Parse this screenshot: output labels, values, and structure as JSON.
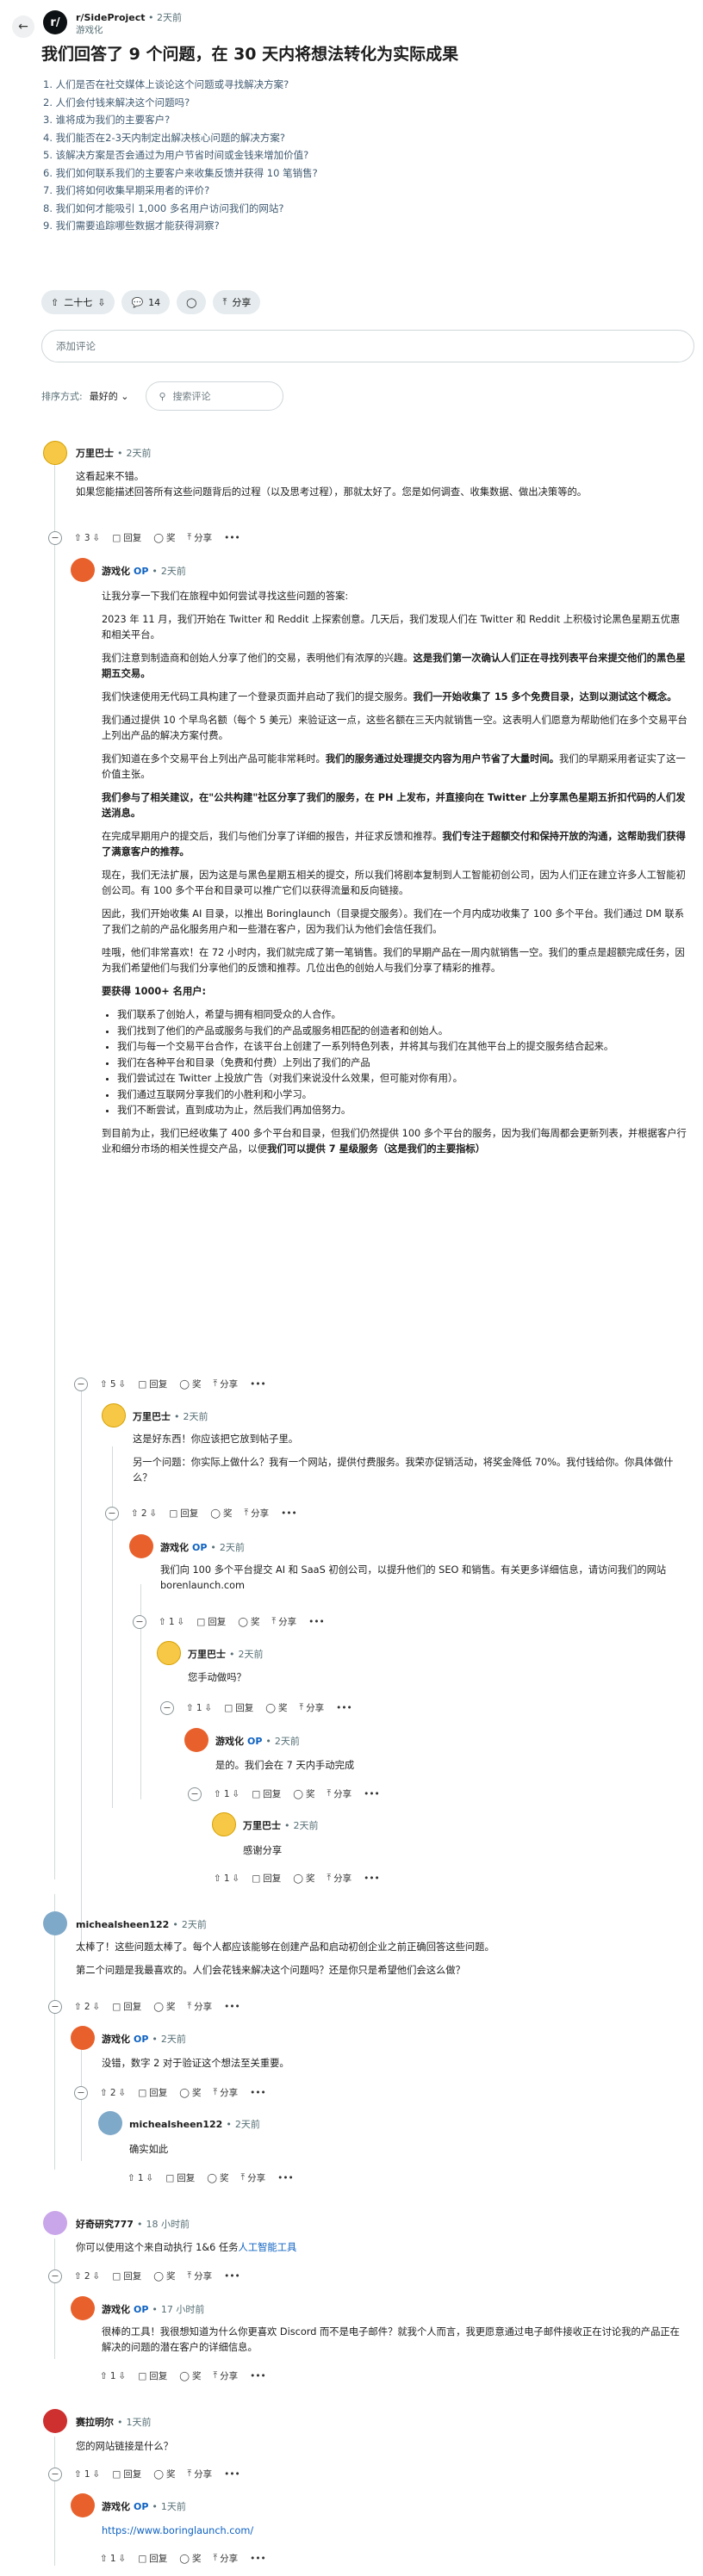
{
  "header": {
    "subreddit": "r/SideProject",
    "age": "2天前",
    "author": "游戏化",
    "title": "我们回答了 9 个问题，在 30 天内将想法转化为实际成果"
  },
  "questions": [
    "1. 人们是否在社交媒体上谈论这个问题或寻找解决方案?",
    "2. 人们会付钱来解决这个问题吗?",
    "3. 谁将成为我们的主要客户?",
    "4. 我们能否在2-3天内制定出解决核心问题的解决方案?",
    "5. 该解决方案是否会通过为用户节省时间或金钱来增加价值?",
    "6. 我们如何联系我们的主要客户来收集反馈并获得 10 笔销售?",
    "7. 我们将如何收集早期采用者的评价?",
    "8. 我们如何才能吸引 1,000 多名用户访问我们的网站?",
    "9. 我们需要追踪哪些数据才能获得洞察?"
  ],
  "post_actions": {
    "votes": "二十七",
    "comments": "14",
    "share": "分享"
  },
  "add_comment_placeholder": "添加评论",
  "sort": {
    "label": "排序方式:",
    "value": "最好的",
    "search_placeholder": "搜索评论"
  },
  "labels": {
    "reply": "回复",
    "award": "奖",
    "share": "分享",
    "op": "OP"
  },
  "comments": {
    "c1": {
      "author": "万里巴士",
      "time": "2天前",
      "votes": "3",
      "text": [
        "这看起来不错。",
        "如果您能描述回答所有这些问题背后的过程（以及思考过程），那就太好了。您是如何调查、收集数据、做出决策等的。"
      ]
    },
    "c1r": {
      "author": "游戏化",
      "time": "2天前",
      "votes": "5",
      "p1": "让我分享一下我们在旅程中如何尝试寻找这些问题的答案:",
      "p2": "2023 年 11 月，我们开始在 Twitter 和 Reddit 上探索创意。几天后，我们发现人们在 Twitter 和 Reddit 上积极讨论黑色星期五优惠和相关平台。",
      "p3a": "我们注意到制造商和创始人分享了他们的交易，表明他们有浓厚的兴趣。",
      "p3b": "这是我们第一次确认人们正在寻找列表平台来提交他们的黑色星期五交易。",
      "p4a": "我们快速使用无代码工具构建了一个登录页面并启动了我们的提交服务。",
      "p4b": "我们一开始收集了 15 多个免费目录，达到以测试这个概念。",
      "p5": "我们通过提供 10 个早鸟名额（每个 5 美元）来验证这一点，这些名额在三天内就销售一空。这表明人们愿意为帮助他们在多个交易平台上列出产品的解决方案付费。",
      "p6a": "我们知道在多个交易平台上列出产品可能非常耗时。",
      "p6b": "我们的服务通过处理提交内容为用户节省了大量时间。",
      "p6c": "我们的早期采用者证实了这一价值主张。",
      "p7": "我们参与了相关建议，在\"公共构建\"社区分享了我们的服务，在 PH 上发布，并直接向在 Twitter 上分享黑色星期五折扣代码的人们发送消息。",
      "p8a": "在完成早期用户的提交后，我们与他们分享了详细的报告，并征求反馈和推荐。",
      "p8b": "我们专注于超额交付和保持开放的沟通，这帮助我们获得了满意客户的推荐。",
      "p9": "现在，我们无法扩展，因为这是与黑色星期五相关的提交，所以我们将剧本复制到人工智能初创公司，因为人们正在建立许多人工智能初创公司。有 100 多个平台和目录可以推广它们以获得流量和反向链接。",
      "p10": "因此，我们开始收集 AI 目录，以推出 Boringlaunch（目录提交服务）。我们在一个月内成功收集了 100 多个平台。我们通过 DM 联系了我们之前的产品化服务用户和一些潜在客户，因为我们认为他们会信任我们。",
      "p11": "哇哦，他们非常喜欢！在 72 小时内，我们就完成了第一笔销售。我们的早期产品在一周内就销售一空。我们的重点是超额完成任务，因为我们希望他们与我们分享他们的反馈和推荐。几位出色的创始人与我们分享了精彩的推荐。",
      "p12": "要获得 1000+ 名用户:",
      "list": [
        "我们联系了创始人，希望与拥有相同受众的人合作。",
        "我们找到了他们的产品或服务与我们的产品或服务相匹配的创造者和创始人。",
        "我们与每一个交易平台合作，在该平台上创建了一系列特色列表，并将其与我们在其他平台上的提交服务结合起来。",
        "我们在各种平台和目录（免费和付费）上列出了我们的产品",
        "我们尝试过在 Twitter 上投放广告（对我们来说没什么效果，但可能对你有用）。",
        "我们通过互联网分享我们的小胜利和小学习。",
        "我们不断尝试，直到成功为止，然后我们再加倍努力。"
      ],
      "p13a": "到目前为止，我们已经收集了 400 多个平台和目录，但我们仍然提供 100 多个平台的服务，因为我们每周都会更新列表，并根据客户行业和细分市场的相关性提交产品，以便",
      "p13b": "我们可以提供 7 星级服务（这是我们的主要指标）"
    },
    "c2": {
      "author": "万里巴士",
      "time": "2天前",
      "votes": "2",
      "text": [
        "这是好东西！你应该把它放到帖子里。",
        "另一个问题：你实际上做什么？我有一个网站，提供付费服务。我荣亦促销活动，将奖金降低 70%。我付钱给你。你具体做什么？"
      ]
    },
    "c3": {
      "author": "游戏化",
      "time": "2天前",
      "votes": "1",
      "text": "我们向 100 多个平台提交 AI 和 SaaS 初创公司，以提升他们的 SEO 和销售。有关更多详细信息，请访问我们的网站 borenlaunch.com"
    },
    "c4": {
      "author": "万里巴士",
      "time": "2天前",
      "votes": "1",
      "text": "您手动做吗？"
    },
    "c5": {
      "author": "游戏化",
      "time": "2天前",
      "votes": "1",
      "text": "是的。我们会在 7 天内手动完成"
    },
    "c6": {
      "author": "万里巴士",
      "time": "2天前",
      "votes": "1",
      "text": "感谢分享"
    },
    "c7": {
      "author": "michealsheen122",
      "time": "2天前",
      "votes": "2",
      "text": [
        "太棒了！这些问题太棒了。每个人都应该能够在创建产品和启动初创企业之前正确回答这些问题。",
        "第二个问题是我最喜欢的。人们会花钱来解决这个问题吗？还是你只是希望他们会这么做？"
      ]
    },
    "c8": {
      "author": "游戏化",
      "time": "2天前",
      "votes": "2",
      "text": "没错，数字 2 对于验证这个想法至关重要。"
    },
    "c9": {
      "author": "michealsheen122",
      "time": "2天前",
      "votes": "1",
      "text": "确实如此"
    },
    "c10": {
      "author": "好奇研究777",
      "time": "18 小时前",
      "votes": "2",
      "text_pre": "你可以使用这个来自动执行 1&6 任务",
      "link": "人工智能工具"
    },
    "c11": {
      "author": "游戏化",
      "time": "17 小时前",
      "votes": "1",
      "text": "很棒的工具！我很想知道为什么你更喜欢 Discord 而不是电子邮件？就我个人而言，我更愿意通过电子邮件接收正在讨论我的产品正在解决的问题的潜在客户的详细信息。"
    },
    "c12": {
      "author": "赛拉明尔",
      "time": "1天前",
      "votes": "1",
      "text": "您的网站链接是什么？"
    },
    "c13": {
      "author": "游戏化",
      "time": "1天前",
      "votes": "1",
      "link": "https://www.boringlaunch.com/"
    }
  }
}
